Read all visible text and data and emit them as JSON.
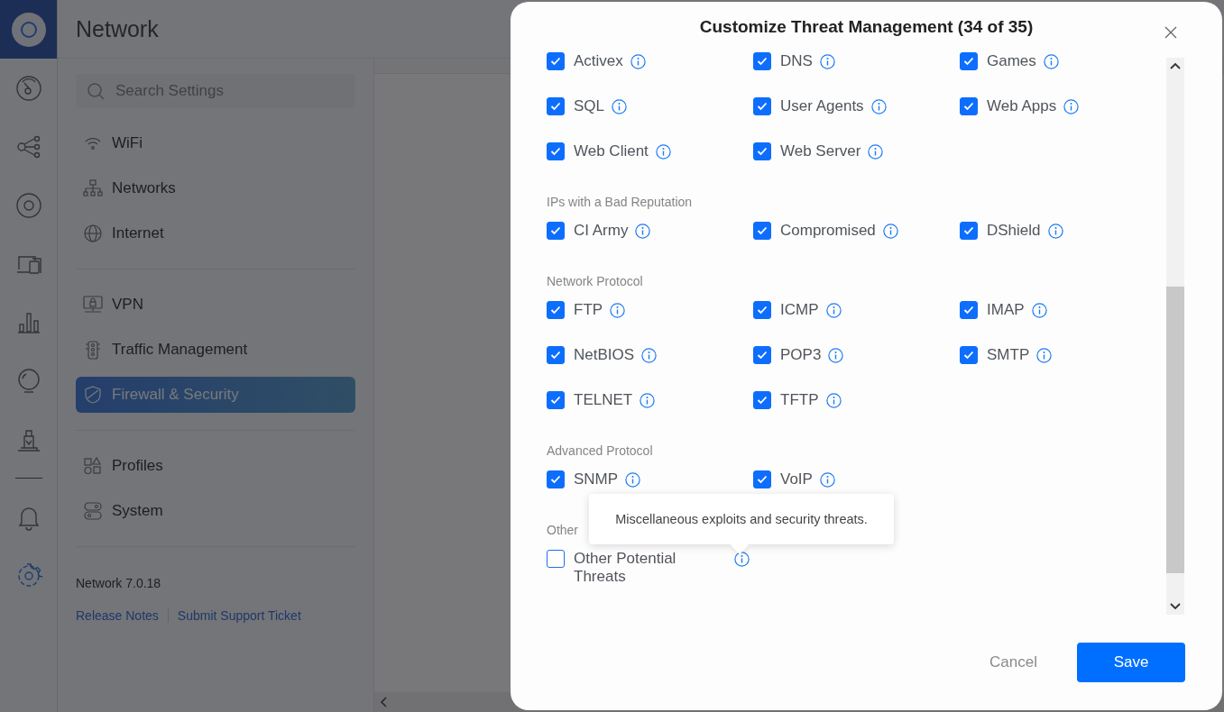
{
  "app": {
    "title": "Network"
  },
  "rail": [
    {
      "selected": false
    },
    {
      "selected": false
    },
    {
      "selected": false
    },
    {
      "selected": false
    },
    {
      "selected": false
    },
    {
      "selected": false
    },
    {
      "selected": false
    },
    {
      "selected": false
    },
    {
      "selected": true
    }
  ],
  "search": {
    "placeholder": "Search Settings"
  },
  "nav": [
    [
      {
        "label": "WiFi",
        "selected": false
      },
      {
        "label": "Networks",
        "selected": false
      },
      {
        "label": "Internet",
        "selected": false
      }
    ],
    [
      {
        "label": "VPN",
        "selected": false
      },
      {
        "label": "Traffic Management",
        "selected": false
      },
      {
        "label": "Firewall & Security",
        "selected": true
      }
    ],
    [
      {
        "label": "Profiles",
        "selected": false
      },
      {
        "label": "System",
        "selected": false
      }
    ]
  ],
  "version": "Network 7.0.18",
  "links": [
    "Release Notes",
    "Submit Support Ticket"
  ],
  "modal": {
    "title": "Customize Threat Management (34 of 35)",
    "groups": [
      {
        "items": [
          {
            "label": "Activex",
            "checked": true
          },
          {
            "label": "DNS",
            "checked": true
          },
          {
            "label": "Games",
            "checked": true
          },
          {
            "label": "SQL",
            "checked": true
          },
          {
            "label": "User Agents",
            "checked": true
          },
          {
            "label": "Web Apps",
            "checked": true
          },
          {
            "label": "Web Client",
            "checked": true
          },
          {
            "label": "Web Server",
            "checked": true
          }
        ]
      },
      {
        "label": "IPs with a Bad Reputation",
        "items": [
          {
            "label": "CI Army",
            "checked": true
          },
          {
            "label": "Compromised",
            "checked": true
          },
          {
            "label": "DShield",
            "checked": true
          }
        ]
      },
      {
        "label": "Network Protocol",
        "items": [
          {
            "label": "FTP",
            "checked": true
          },
          {
            "label": "ICMP",
            "checked": true
          },
          {
            "label": "IMAP",
            "checked": true
          },
          {
            "label": "NetBIOS",
            "checked": true
          },
          {
            "label": "POP3",
            "checked": true
          },
          {
            "label": "SMTP",
            "checked": true
          },
          {
            "label": "TELNET",
            "checked": true
          },
          {
            "label": "TFTP",
            "checked": true
          }
        ]
      },
      {
        "label": "Advanced Protocol",
        "items": [
          {
            "label": "SNMP",
            "checked": true
          },
          {
            "label": "VoIP",
            "checked": true
          }
        ]
      },
      {
        "label": "Other",
        "items": [
          {
            "label": "Other Potential Threats",
            "checked": false
          }
        ]
      }
    ],
    "tooltip": "Miscellaneous exploits and security threats.",
    "cancel": "Cancel",
    "save": "Save"
  }
}
